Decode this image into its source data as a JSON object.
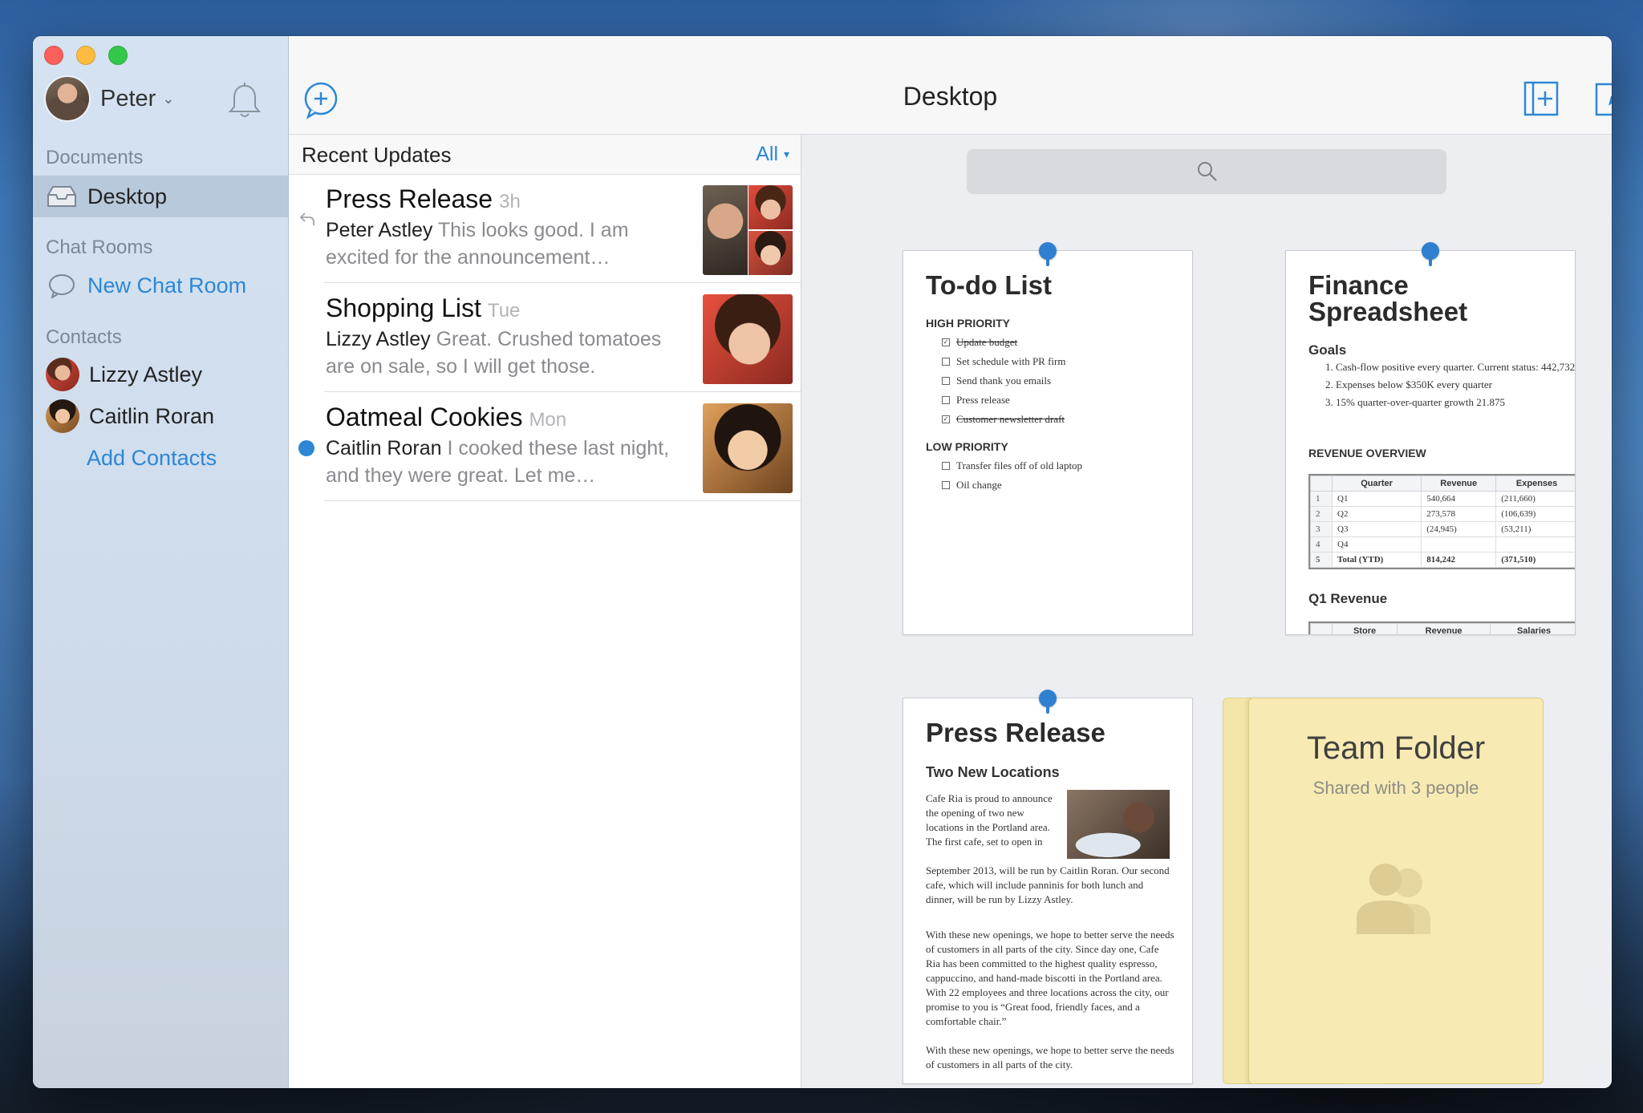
{
  "window": {
    "title": "Desktop"
  },
  "sidebar": {
    "user_name": "Peter",
    "sections": {
      "documents": "Documents",
      "chat_rooms": "Chat Rooms",
      "contacts": "Contacts"
    },
    "documents_items": [
      {
        "label": "Desktop",
        "selected": true
      }
    ],
    "chat_items": [
      {
        "label": "New Chat Room"
      }
    ],
    "contacts": [
      {
        "name": "Lizzy Astley"
      },
      {
        "name": "Caitlin Roran"
      }
    ],
    "add_contacts": "Add Contacts"
  },
  "updates": {
    "header": "Recent Updates",
    "filter": "All",
    "items": [
      {
        "title": "Press Release",
        "time": "3h",
        "author": "Peter Astley",
        "preview": "This looks good. I am excited for the announcement…",
        "state": "replied"
      },
      {
        "title": "Shopping List",
        "time": "Tue",
        "author": "Lizzy Astley",
        "preview": "Great. Crushed tomatoes are on sale, so I will get those.",
        "state": "read"
      },
      {
        "title": "Oatmeal Cookies",
        "time": "Mon",
        "author": "Caitlin Roran",
        "preview": "I cooked these last night, and they were great. Let me…",
        "state": "unread"
      }
    ]
  },
  "desktop": {
    "search_icon": "search-icon",
    "todo": {
      "title": "To-do List",
      "high_label": "HIGH PRIORITY",
      "high_items": [
        {
          "text": "Update budget",
          "done": true
        },
        {
          "text": "Set schedule with PR firm",
          "done": false
        },
        {
          "text": "Send thank you emails",
          "done": false
        },
        {
          "text": "Press release",
          "done": false
        },
        {
          "text": "Customer newsletter draft",
          "done": true
        }
      ],
      "low_label": "LOW PRIORITY",
      "low_items": [
        {
          "text": "Transfer files off of old laptop",
          "done": false
        },
        {
          "text": "Oil change",
          "done": false
        }
      ]
    },
    "finance": {
      "title_line1": "Finance",
      "title_line2": "Spreadsheet",
      "goals_label": "Goals",
      "goals": [
        "Cash-flow positive every quarter. Current status: 442,732",
        "Expenses below $350K every quarter",
        "15% quarter-over-quarter growth 21.875"
      ],
      "overview_label": "REVENUE OVERVIEW",
      "table_headers": [
        "Quarter",
        "Revenue",
        "Expenses"
      ],
      "table_rows": [
        {
          "n": "1",
          "q": "Q1",
          "rev": "540,664",
          "exp": "(211,660)"
        },
        {
          "n": "2",
          "q": "Q2",
          "rev": "273,578",
          "exp": "(106,639)"
        },
        {
          "n": "3",
          "q": "Q3",
          "rev": "(24,945)",
          "exp": "(53,211)"
        },
        {
          "n": "4",
          "q": "Q4",
          "rev": "",
          "exp": ""
        },
        {
          "n": "5",
          "q": "Total (YTD)",
          "rev": "814,242",
          "exp": "(371,510)"
        }
      ],
      "q1_label": "Q1 Revenue",
      "q1_headers": [
        "Store",
        "Revenue",
        "Salaries"
      ]
    },
    "press": {
      "title": "Press Release",
      "subtitle": "Two New Locations",
      "para1_wrap": "Cafe Ria is proud to announce the opening of two new locations in the Portland area. The first cafe, set to open in",
      "para1_rest": "September 2013, will be run by Caitlin Roran. Our second cafe, which will include panninis for both lunch and dinner, will be run by Lizzy Astley.",
      "para2": "With these new openings, we hope to better serve the needs of customers in all parts of the city. Since day one, Cafe Ria has been committed to the highest quality espresso, cappuccino, and hand-made biscotti in the Portland area. With 22 employees and three locations across the city, our promise to you is “Great food, friendly faces, and a comfortable chair.”",
      "para3": "With these new openings, we hope to better serve the needs of customers in all parts of the city."
    },
    "folder": {
      "title": "Team Folder",
      "subtitle": "Shared with 3 people"
    }
  }
}
